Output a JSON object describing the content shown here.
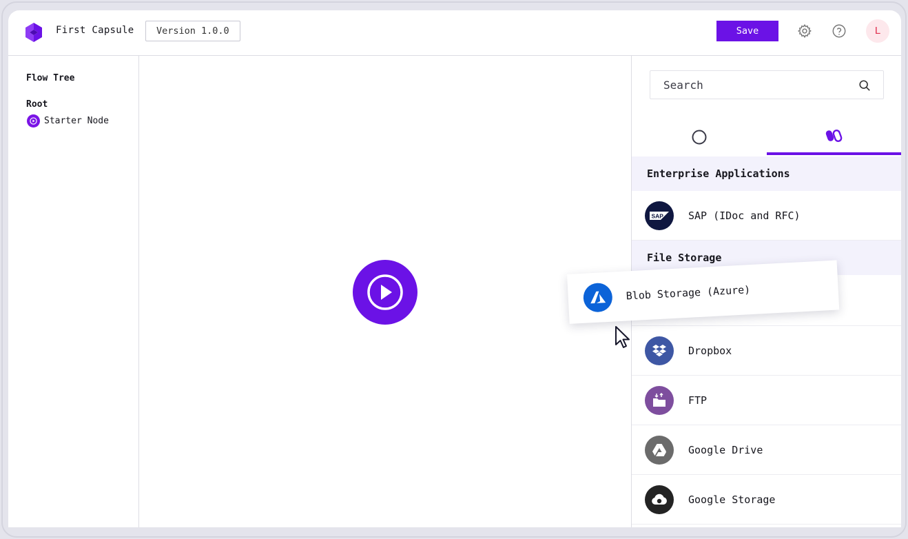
{
  "header": {
    "app_title": "First Capsule",
    "version_label": "Version 1.0.0",
    "save_label": "Save",
    "avatar_initial": "L"
  },
  "flow_tree": {
    "title": "Flow Tree",
    "root_label": "Root",
    "starter_label": "Starter Node"
  },
  "search": {
    "placeholder": "Search"
  },
  "categories": {
    "enterprise": "Enterprise Applications",
    "file_storage": "File Storage"
  },
  "connectors": {
    "sap": "SAP (IDoc and RFC)",
    "dropbox": "Dropbox",
    "ftp": "FTP",
    "gdrive": "Google Drive",
    "gstorage": "Google Storage"
  },
  "dragging": {
    "label": "Blob Storage (Azure)"
  },
  "colors": {
    "accent": "#6b12e6",
    "sap": "#0f1740",
    "azure": "#0c63d8",
    "dropbox": "#3e57a4",
    "ftp": "#7e4e9e",
    "gdrive": "#6b6b6b",
    "gstorage": "#232323"
  }
}
